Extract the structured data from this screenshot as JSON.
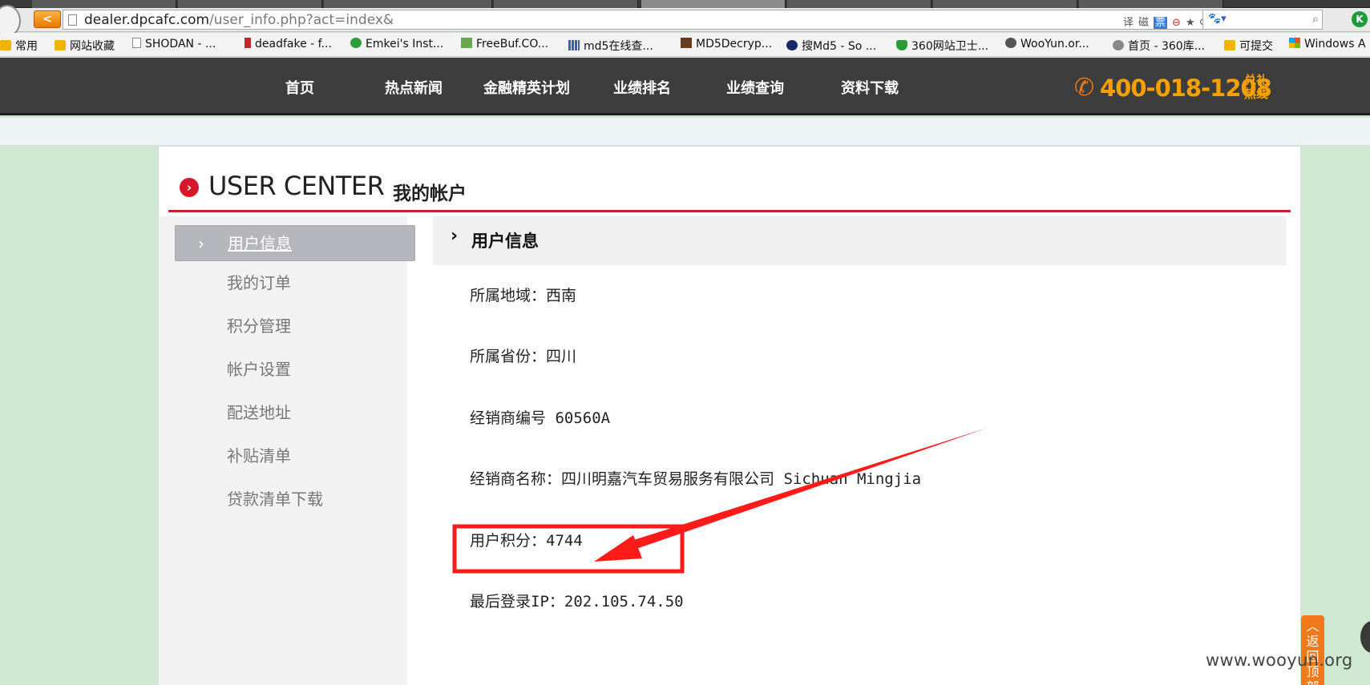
{
  "browser": {
    "url_host": "dealer.dpcafc.com",
    "url_path": "/user_info.php?act=index&",
    "back_label": "<",
    "tools": [
      "译",
      "磁",
      "票"
    ],
    "k_label": "K"
  },
  "bookmarks": [
    {
      "label": "常用",
      "icon": "folder-icon"
    },
    {
      "label": "网站收藏",
      "icon": "folder-icon"
    },
    {
      "label": "SHODAN - ...",
      "icon": "page-icon"
    },
    {
      "label": "deadfake - f...",
      "icon": "red-bar-icon"
    },
    {
      "label": "Emkei's Inst...",
      "icon": "green-leaf-icon"
    },
    {
      "label": "FreeBuf.CO...",
      "icon": "freebuf-icon"
    },
    {
      "label": "md5在线查...",
      "icon": "grid-icon"
    },
    {
      "label": "MD5Decryp...",
      "icon": "md5decrypt-icon"
    },
    {
      "label": "搜Md5 - So ...",
      "icon": "md5-icon"
    },
    {
      "label": "360网站卫士...",
      "icon": "shield-icon"
    },
    {
      "label": "WooYun.or...",
      "icon": "wooyun-icon"
    },
    {
      "label": "首页 - 360库...",
      "icon": "star-icon"
    },
    {
      "label": "可提交",
      "icon": "folder-icon"
    },
    {
      "label": "Windows A",
      "icon": "windows-icon"
    }
  ],
  "site_nav": {
    "items": [
      "首页",
      "热点新闻",
      "金融精英计划",
      "业绩排名",
      "业绩查询",
      "资料下载"
    ],
    "phone": "400-018-1208",
    "hotline_label": "兑礼热线"
  },
  "user_center": {
    "title_en": "USER CENTER",
    "title_cn": "我的帐户"
  },
  "sidebar": {
    "items": [
      {
        "label": "用户信息",
        "active": true
      },
      {
        "label": "我的订单",
        "active": false
      },
      {
        "label": "积分管理",
        "active": false
      },
      {
        "label": "帐户设置",
        "active": false
      },
      {
        "label": "配送地址",
        "active": false
      },
      {
        "label": "补贴清单",
        "active": false
      },
      {
        "label": "贷款清单下载",
        "active": false
      }
    ]
  },
  "content": {
    "section_title": "用户信息",
    "fields": [
      "所属地域：西南",
      "所属省份：四川",
      "经销商编号 60560A",
      "经销商名称：四川明嘉汽车贸易服务有限公司 Sichuan Mingjia",
      "用户积分：4744",
      "最后登录IP：202.105.74.50"
    ]
  },
  "annotation": {
    "color": "#ff1a1a"
  },
  "back_to_top": "返回顶部",
  "watermark": "www.wooyun.org"
}
